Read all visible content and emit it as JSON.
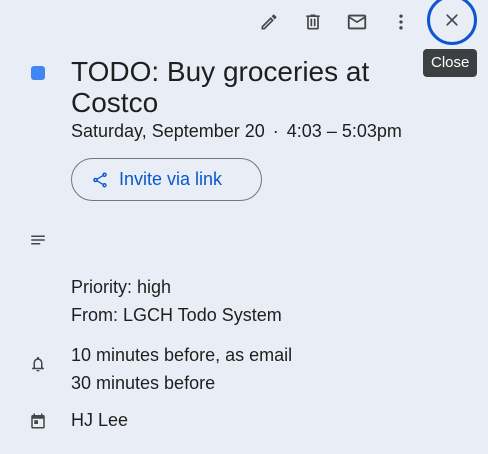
{
  "toolbar": {
    "edit_icon": "pencil-icon",
    "delete_icon": "trash-icon",
    "email_icon": "envelope-icon",
    "more_icon": "more-vertical-icon",
    "close_icon": "close-icon"
  },
  "tooltip": {
    "text": "Close"
  },
  "event": {
    "color": "#4285f4",
    "title": "TODO: Buy groceries at Costco",
    "date": "Saturday, September 20",
    "separator": "·",
    "time": "4:03 – 5:03pm"
  },
  "invite": {
    "label": "Invite via link",
    "icon": "share-icon"
  },
  "description": {
    "icon": "description-lines-icon",
    "lines": [
      "Priority: high",
      "From: LGCH Todo System"
    ]
  },
  "notifications": {
    "icon": "bell-icon",
    "items": [
      "10 minutes before, as email",
      "30 minutes before"
    ]
  },
  "calendar": {
    "icon": "calendar-icon",
    "owner": "HJ Lee"
  },
  "colors": {
    "background": "#e9eef6",
    "accent": "#0b57d0",
    "event_color": "#4285f4",
    "tooltip_bg": "#3c4043"
  }
}
